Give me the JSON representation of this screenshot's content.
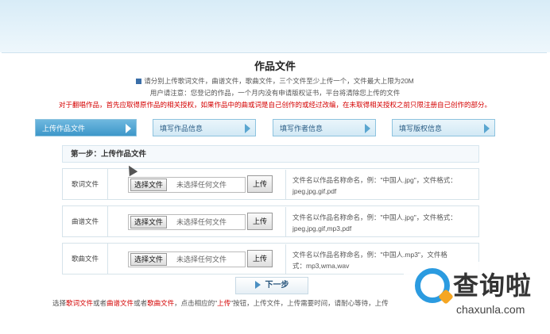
{
  "page": {
    "title": "作品文件",
    "note1": "请分别上传歌词文件，曲谱文件，歌曲文件，三个文件至少上传一个，文件最大上限为20M",
    "note2": "用户请注意：您登记的作品，一个月内没有申请版权证书，平台将清除您上传的文件",
    "note3": "对于翻唱作品，首先应取得原作品的相关授权，如果作品中的曲或词是自己创作的或经过改编，在未取得相关授权之前只限注册自己创作的部分。"
  },
  "steps": [
    {
      "label": "上传作品文件",
      "active": true
    },
    {
      "label": "填写作品信息",
      "active": false
    },
    {
      "label": "填写作者信息",
      "active": false
    },
    {
      "label": "填写版权信息",
      "active": false
    }
  ],
  "section": {
    "title": "第一步：上传作品文件"
  },
  "rows": [
    {
      "label": "歌词文件",
      "choose": "选择文件",
      "nofile": "未选择任何文件",
      "upload": "上传",
      "hint1": "文件名以作品名称命名，例：\"中国人.jpg\"，文件格式：",
      "hint2": "jpeg,jpg,gif,pdf"
    },
    {
      "label": "曲谱文件",
      "choose": "选择文件",
      "nofile": "未选择任何文件",
      "upload": "上传",
      "hint1": "文件名以作品名称命名，例：\"中国人.jpg\"，文件格式：",
      "hint2": "jpeg,jpg,gif,mp3,pdf"
    },
    {
      "label": "歌曲文件",
      "choose": "选择文件",
      "nofile": "未选择任何文件",
      "upload": "上传",
      "hint1": "文件名以作品名称命名，例：\"中国人.mp3\"，文件格",
      "hint2": "式：mp3,wma,wav"
    }
  ],
  "next": {
    "label": "下一步"
  },
  "footer": {
    "t1": "选择",
    "r1": "歌词文件",
    "t2": "或者",
    "r2": "曲谱文件",
    "t3": "或者",
    "r3": "歌曲文件",
    "t4": "，点击相应的\"",
    "r4": "上传",
    "t5": "\"按钮，上传文件，上传需要时间，请耐心等待，上传"
  },
  "watermark": {
    "text": "查询啦",
    "url": "chaxunla.com"
  },
  "colors": {
    "accent": "#3d97c9",
    "warning": "#d40000"
  }
}
